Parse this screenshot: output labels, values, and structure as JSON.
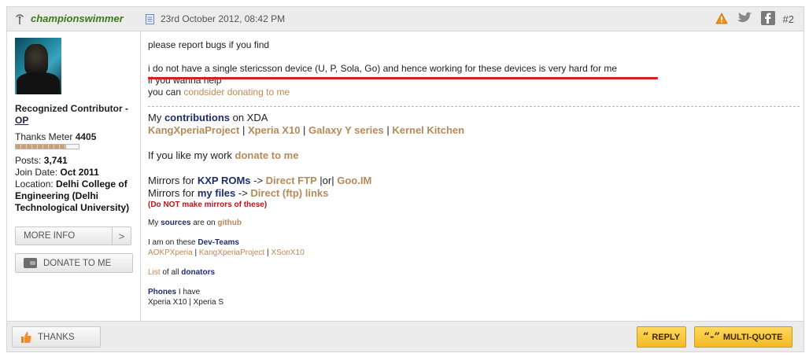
{
  "post": {
    "username": "championswimmer",
    "date": "23rd October 2012, 08:42 PM",
    "post_number": "#2",
    "icons": [
      "report-icon",
      "twitter-icon",
      "facebook-icon"
    ]
  },
  "sidebar": {
    "title_line1": "Recognized Contributor -",
    "title_line2": "OP",
    "thanks_label": "Thanks Meter",
    "thanks_value": "4405",
    "thanks_meter_fraction": 0.8,
    "posts_label": "Posts:",
    "posts_value": "3,741",
    "join_label": "Join Date:",
    "join_value": "Oct 2011",
    "location_label": "Location:",
    "location_value_1": "Delhi College of",
    "location_value_2": "Engineering (Delhi",
    "location_value_3": "Technological University)",
    "more_info": "MORE INFO",
    "more_chevron": ">",
    "donate": "DONATE TO ME"
  },
  "message": {
    "line1": "please report bugs if you find",
    "line2": "i do not have a single stericsson device (U, P, Sola, Go) and hence working for these devices is very hard for me",
    "line3": "if you wanna help",
    "line4_prefix": "you can ",
    "line4_link": "condsider donating to me"
  },
  "signature": {
    "contrib_prefix": "My ",
    "contrib_bold": "contributions",
    "contrib_suffix": " on XDA",
    "projects": [
      "KangXperiaProject",
      "Xperia X10",
      "Galaxy Y series",
      "Kernel Kitchen"
    ],
    "project_sep": " | ",
    "like_prefix": "If you like my work ",
    "like_link": "donate to me",
    "mirrors1_prefix": "Mirrors for ",
    "mirrors1_bold": "KXP ROMs",
    "mirrors1_arrow": " -> ",
    "mirrors1_link1": "Direct FTP",
    "mirrors1_or": " |or| ",
    "mirrors1_link2": "Goo.IM",
    "mirrors2_prefix": "Mirrors for ",
    "mirrors2_bold": "my files",
    "mirrors2_arrow": " -> ",
    "mirrors2_link": "Direct (ftp) links",
    "warning": "(Do NOT make mirrors of these)",
    "sources_prefix": "My ",
    "sources_bold": "sources",
    "sources_mid": " are on ",
    "sources_link": "github",
    "teams_prefix": "I am on these ",
    "teams_bold": "Dev-Teams",
    "teams": [
      "AOKPXperia",
      "KangXperiaProject",
      "XSonX10"
    ],
    "list_link": "List",
    "list_mid": " of all ",
    "list_bold": "donators",
    "phones_bold": "Phones",
    "phones_suffix": " I have",
    "phones_list": "Xperia X10 | Xperia S"
  },
  "footer": {
    "thanks": "THANKS",
    "reply": "REPLY",
    "reply_quote": "“",
    "multi_quote": "MULTI-QUOTE",
    "mq_quote": "“-”"
  },
  "colors": {
    "username": "#3a7a1a",
    "accent_link": "#c2884f",
    "navy": "#1f2e6b",
    "button_yellow": "#f3b928",
    "underline_red": "#d21f1f"
  }
}
